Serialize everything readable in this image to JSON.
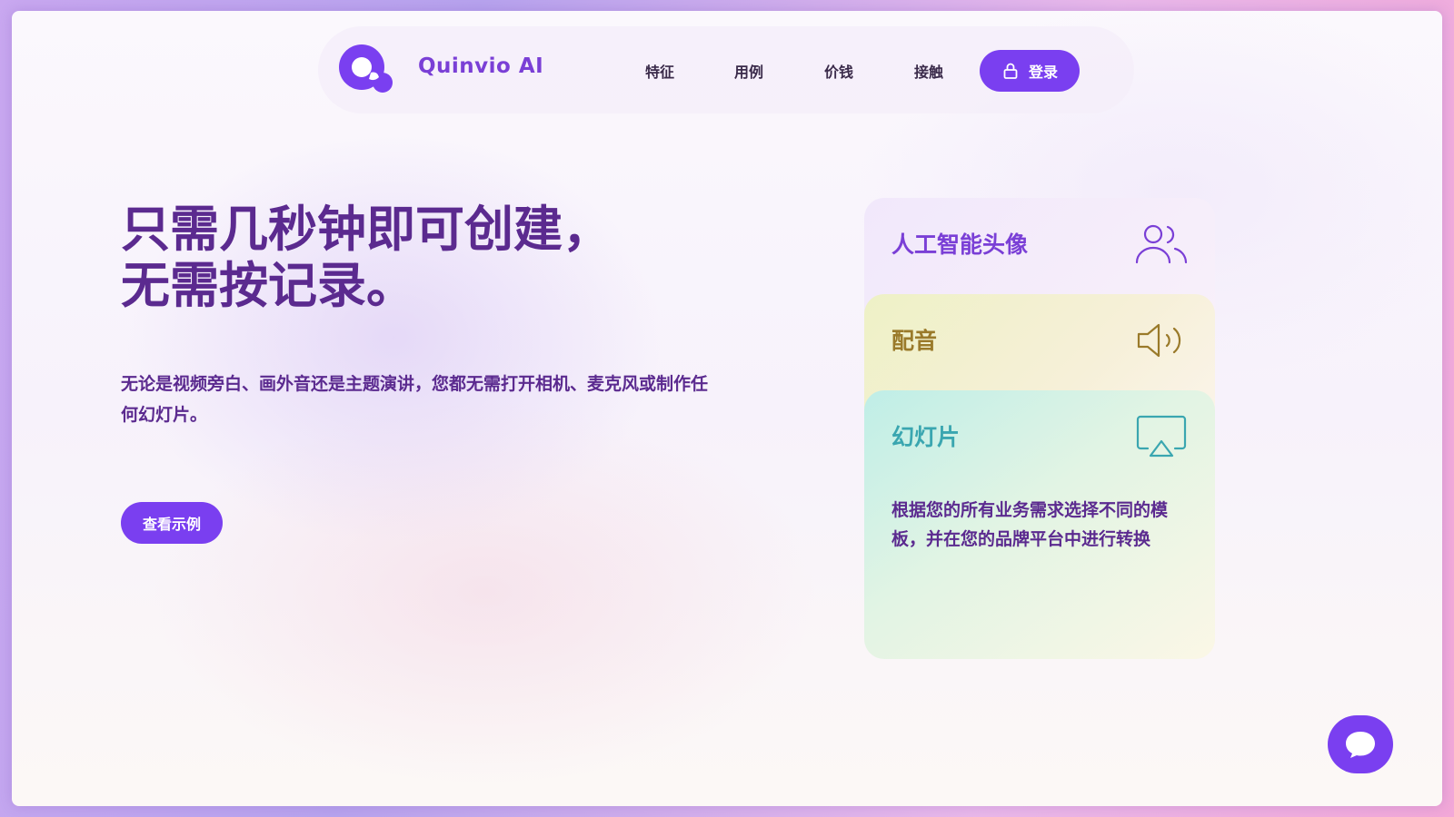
{
  "brand": {
    "name": "Quinvio AI",
    "accent_color": "#7a3ff0"
  },
  "nav": {
    "items": [
      {
        "label": "特征"
      },
      {
        "label": "用例"
      },
      {
        "label": "价钱"
      },
      {
        "label": "接触"
      }
    ],
    "login_label": "登录",
    "login_icon": "lock-icon"
  },
  "hero": {
    "title_line1": "只需几秒钟即可创建，",
    "title_line2": "无需按记录。",
    "description": "无论是视频旁白、画外音还是主题演讲，您都无需打开相机、麦克风或制作任何幻灯片。",
    "cta_label": "查看示例"
  },
  "cards": [
    {
      "title": "人工智能头像",
      "icon": "users-icon",
      "color": "#7a3fd6"
    },
    {
      "title": "配音",
      "icon": "speaker-icon",
      "color": "#9a7a2a"
    },
    {
      "title": "幻灯片",
      "icon": "airplay-icon",
      "color": "#3aa6b0",
      "description": "根据您的所有业务需求选择不同的模板，并在您的品牌平台中进行转换"
    }
  ],
  "chat": {
    "icon": "chat-bubble-icon"
  }
}
